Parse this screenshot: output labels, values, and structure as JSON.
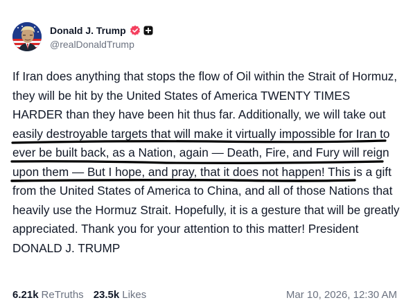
{
  "post": {
    "author": {
      "display_name": "Donald J. Trump",
      "handle": "@realDonaldTrump",
      "verified_icon": "verified-badge-icon",
      "extra_icon": "plus-square-icon",
      "accent_color": "#F43F5E"
    },
    "body": "If Iran does anything that stops the flow of Oil within the Strait of Hormuz, they will be hit by the United States of America TWENTY TIMES HARDER than they have been hit thus far. Additionally, we will take out easily destroyable targets that will make it virtually impossible for Iran to ever be built back, as a Nation, again — Death, Fire, and Fury will reign upon them — But I hope, and pray, that it does not happen! This is a gift from the United States of America to China, and all of those Nations that heavily use the Hormuz Strait. Hopefully, it is a gesture that will be greatly appreciated. Thank you for your attention to this matter! President DONALD J. TRUMP",
    "stats": {
      "retruths_value": "6.21k",
      "retruths_label": "ReTruths",
      "likes_value": "23.5k",
      "likes_label": "Likes"
    },
    "timestamp": "Mar 10, 2026, 12:30 AM",
    "annotation_color": "#000000"
  }
}
